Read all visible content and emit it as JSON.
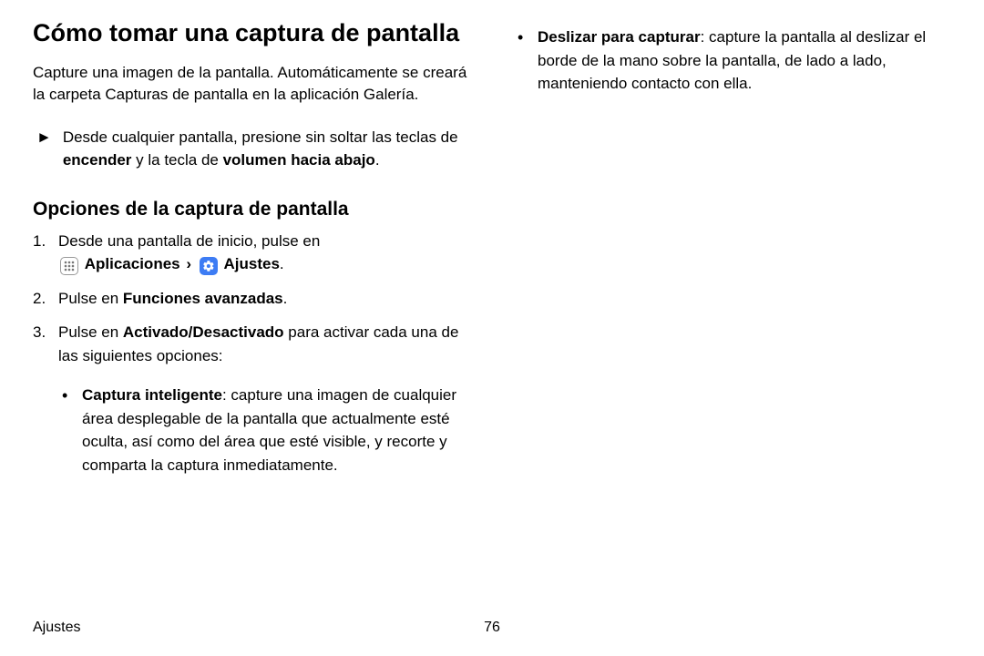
{
  "title": "Cómo tomar una captura de pantalla",
  "intro": "Capture una imagen de la pantalla. Automáticamente se creará la carpeta Capturas de pantalla en la aplicación Galería.",
  "tri_marker": "►",
  "tri_text_pre": "Desde cualquier pantalla, presione sin soltar las teclas de ",
  "tri_bold1": "encender",
  "tri_mid": " y la tecla de ",
  "tri_bold2": "volumen hacia abajo",
  "tri_suffix": ".",
  "subheading": "Opciones de la captura de pantalla",
  "step1_pre": "Desde una pantalla de inicio, pulse en ",
  "apps_label": "Aplicaciones",
  "chevron": "›",
  "settings_label": "Ajustes",
  "step1_suffix": ".",
  "step2_pre": "Pulse en ",
  "step2_bold": "Funciones avanzadas",
  "step2_suffix": ".",
  "step3_pre": "Pulse en ",
  "step3_bold": "Activado/Desactivado",
  "step3_post": " para activar cada una de las siguientes opciones:",
  "bullet1_bold": "Captura inteligente",
  "bullet1_text": ": capture una imagen de cualquier área desplegable de la pantalla que actualmente esté oculta, así como del área que esté visible, y recorte y comparta la captura inmediatamente.",
  "bullet2_bold": "Deslizar para capturar",
  "bullet2_text": ": capture la pantalla al deslizar el borde de la mano sobre la pantalla, de lado a lado, manteniendo contacto con ella.",
  "footer_section": "Ajustes",
  "footer_page": "76"
}
